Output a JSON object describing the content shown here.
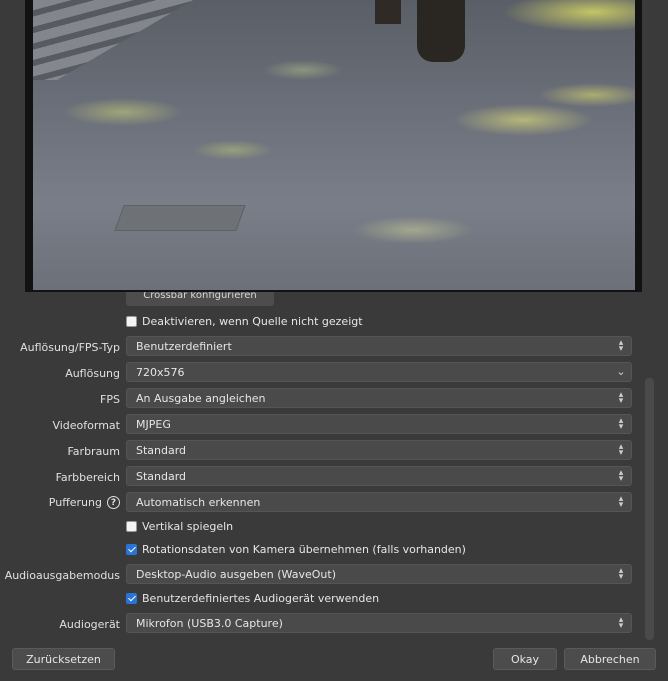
{
  "preview": {
    "description_icon": "video-preview"
  },
  "crossbar_button": "Crossbar konfigurieren",
  "deactivate_checkbox": {
    "label": "Deaktivieren, wenn Quelle nicht gezeigt",
    "checked": false
  },
  "fields": {
    "res_fps_type": {
      "label": "Auflösung/FPS-Typ",
      "value": "Benutzerdefiniert"
    },
    "resolution": {
      "label": "Auflösung",
      "value": "720x576"
    },
    "fps": {
      "label": "FPS",
      "value": "An Ausgabe angleichen"
    },
    "video_format": {
      "label": "Videoformat",
      "value": "MJPEG"
    },
    "color_space": {
      "label": "Farbraum",
      "value": "Standard"
    },
    "color_range": {
      "label": "Farbbereich",
      "value": "Standard"
    },
    "buffering": {
      "label": "Pufferung",
      "value": "Automatisch erkennen"
    },
    "audio_output_mode": {
      "label": "Audioausgabemodus",
      "value": "Desktop-Audio ausgeben (WaveOut)"
    },
    "audio_device": {
      "label": "Audiogerät",
      "value": "Mikrofon (USB3.0 Capture)"
    }
  },
  "checkboxes": {
    "flip_vertical": {
      "label": "Vertikal spiegeln",
      "checked": false
    },
    "rotation": {
      "label": "Rotationsdaten von Kamera übernehmen (falls vorhanden)",
      "checked": true
    },
    "custom_audio": {
      "label": "Benutzerdefiniertes Audiogerät verwenden",
      "checked": true
    }
  },
  "buttons": {
    "reset": "Zurücksetzen",
    "ok": "Okay",
    "cancel": "Abbrechen"
  },
  "colors": {
    "accent": "#2a74d8",
    "background": "#3a3a3a",
    "control": "#4a4a4a"
  }
}
